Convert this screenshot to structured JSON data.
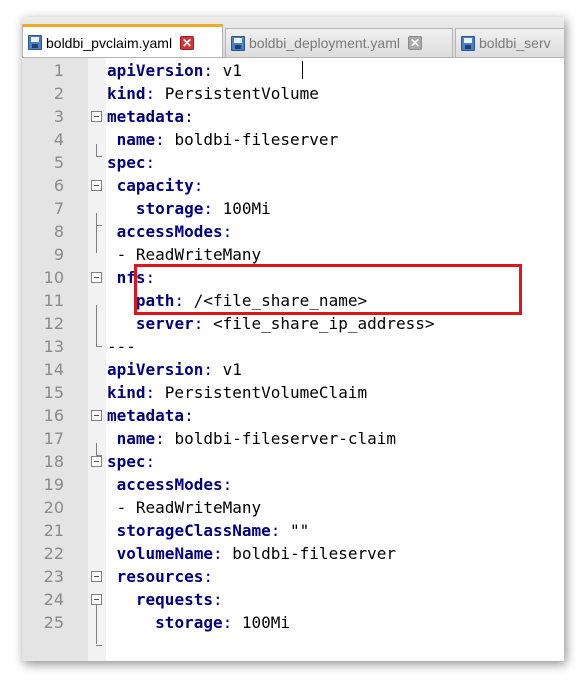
{
  "tabs": [
    {
      "label": "boldbi_pvclaim.yaml",
      "active": true
    },
    {
      "label": "boldbi_deployment.yaml",
      "active": false
    },
    {
      "label": "boldbi_serv",
      "active": false
    }
  ],
  "icons": {
    "file": "save-icon",
    "close": "close-icon"
  },
  "colors": {
    "keyword": "#000080",
    "highlight": "#e0141b",
    "active_tab_accent": "#f5a623"
  },
  "lines": [
    {
      "num": "1",
      "indent": "",
      "key": "apiVersion",
      "sep": ": ",
      "value": "v1"
    },
    {
      "num": "2",
      "indent": "",
      "key": "kind",
      "sep": ": ",
      "value": "PersistentVolume"
    },
    {
      "num": "3",
      "indent": "",
      "key": "metadata",
      "sep": ":",
      "value": ""
    },
    {
      "num": "4",
      "indent": " ",
      "key": "name",
      "sep": ": ",
      "value": "boldbi-fileserver"
    },
    {
      "num": "5",
      "indent": "",
      "key": "spec",
      "sep": ":",
      "value": ""
    },
    {
      "num": "6",
      "indent": " ",
      "key": "capacity",
      "sep": ":",
      "value": ""
    },
    {
      "num": "7",
      "indent": "   ",
      "key": "storage",
      "sep": ": ",
      "value": "100Mi"
    },
    {
      "num": "8",
      "indent": " ",
      "key": "accessModes",
      "sep": ":",
      "value": ""
    },
    {
      "num": "9",
      "indent": " ",
      "key": "",
      "sep": "",
      "value": "- ReadWriteMany"
    },
    {
      "num": "10",
      "indent": " ",
      "key": "nfs",
      "sep": ":",
      "value": ""
    },
    {
      "num": "11",
      "indent": "   ",
      "key": "path",
      "sep": ": ",
      "value": "/<file_share_name>"
    },
    {
      "num": "12",
      "indent": "   ",
      "key": "server",
      "sep": ": ",
      "value": "<file_share_ip_address>"
    },
    {
      "num": "13",
      "indent": "",
      "key": "",
      "sep": "",
      "value": "---"
    },
    {
      "num": "14",
      "indent": "",
      "key": "apiVersion",
      "sep": ": ",
      "value": "v1"
    },
    {
      "num": "15",
      "indent": "",
      "key": "kind",
      "sep": ": ",
      "value": "PersistentVolumeClaim"
    },
    {
      "num": "16",
      "indent": "",
      "key": "metadata",
      "sep": ":",
      "value": ""
    },
    {
      "num": "17",
      "indent": " ",
      "key": "name",
      "sep": ": ",
      "value": "boldbi-fileserver-claim"
    },
    {
      "num": "18",
      "indent": "",
      "key": "spec",
      "sep": ":",
      "value": ""
    },
    {
      "num": "19",
      "indent": " ",
      "key": "accessModes",
      "sep": ":",
      "value": ""
    },
    {
      "num": "20",
      "indent": " ",
      "key": "",
      "sep": "",
      "value": "- ReadWriteMany"
    },
    {
      "num": "21",
      "indent": " ",
      "key": "storageClassName",
      "sep": ": ",
      "value": "\"\""
    },
    {
      "num": "22",
      "indent": " ",
      "key": "volumeName",
      "sep": ": ",
      "value": "boldbi-fileserver"
    },
    {
      "num": "23",
      "indent": " ",
      "key": "resources",
      "sep": ":",
      "value": ""
    },
    {
      "num": "24",
      "indent": "   ",
      "key": "requests",
      "sep": ":",
      "value": ""
    },
    {
      "num": "25",
      "indent": "     ",
      "key": "storage",
      "sep": ": ",
      "value": "100Mi"
    }
  ]
}
